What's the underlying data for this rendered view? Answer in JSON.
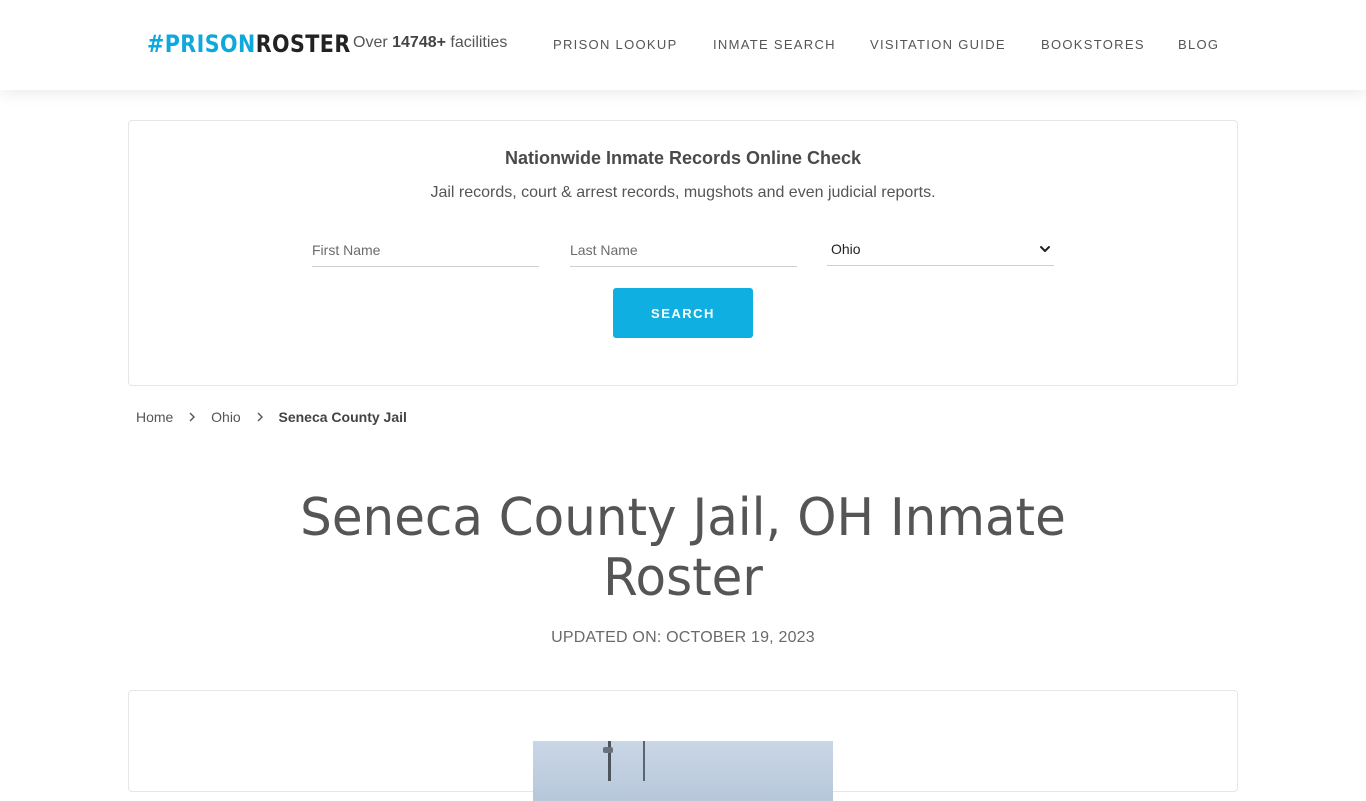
{
  "header": {
    "logo": {
      "part1": "#PRISON",
      "part2": "ROSTER"
    },
    "facilities": {
      "prefix": "Over",
      "count": "14748+",
      "suffix": "facilities"
    },
    "nav": [
      {
        "label": "PRISON LOOKUP"
      },
      {
        "label": "INMATE SEARCH"
      },
      {
        "label": "VISITATION GUIDE"
      },
      {
        "label": "BOOKSTORES"
      },
      {
        "label": "BLOG"
      }
    ]
  },
  "search": {
    "title": "Nationwide Inmate Records Online Check",
    "subtitle": "Jail records, court & arrest records, mugshots and even judicial reports.",
    "first_name_placeholder": "First Name",
    "last_name_placeholder": "Last Name",
    "state_selected": "Ohio",
    "button_label": "SEARCH"
  },
  "breadcrumb": {
    "items": [
      {
        "label": "Home"
      },
      {
        "label": "Ohio"
      },
      {
        "label": "Seneca County Jail"
      }
    ]
  },
  "page": {
    "title": "Seneca County Jail, OH Inmate Roster",
    "updated": "UPDATED ON: OCTOBER 19, 2023"
  },
  "colors": {
    "accent": "#0fb0e1",
    "logo_accent": "#0fa8dc",
    "text": "#555555"
  },
  "icons": {
    "breadcrumb_separator": "chevron-right-icon",
    "select_arrow": "chevron-down-icon"
  }
}
